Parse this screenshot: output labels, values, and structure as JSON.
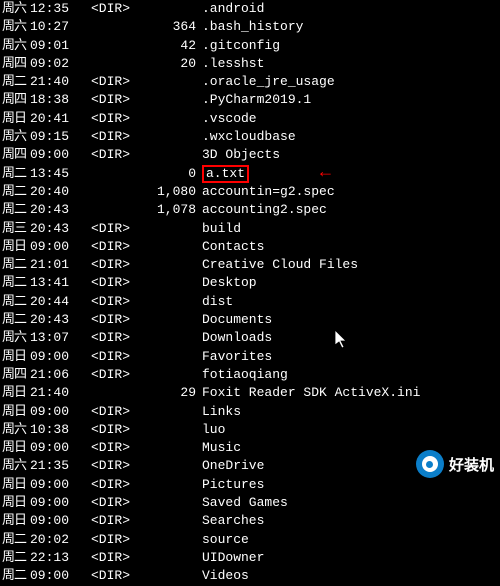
{
  "rows": [
    {
      "day": "六",
      "time": "12:35",
      "dir": "<DIR>",
      "size": "",
      "name": ".android"
    },
    {
      "day": "六",
      "time": "10:27",
      "dir": "",
      "size": "364",
      "name": ".bash_history"
    },
    {
      "day": "六",
      "time": "09:01",
      "dir": "",
      "size": "42",
      "name": ".gitconfig"
    },
    {
      "day": "四",
      "time": "09:02",
      "dir": "",
      "size": "20",
      "name": ".lesshst"
    },
    {
      "day": "二",
      "time": "21:40",
      "dir": "<DIR>",
      "size": "",
      "name": ".oracle_jre_usage"
    },
    {
      "day": "四",
      "time": "18:38",
      "dir": "<DIR>",
      "size": "",
      "name": ".PyCharm2019.1"
    },
    {
      "day": "日",
      "time": "20:41",
      "dir": "<DIR>",
      "size": "",
      "name": ".vscode"
    },
    {
      "day": "六",
      "time": "09:15",
      "dir": "<DIR>",
      "size": "",
      "name": ".wxcloudbase"
    },
    {
      "day": "四",
      "time": "09:00",
      "dir": "<DIR>",
      "size": "",
      "name": "3D Objects"
    },
    {
      "day": "二",
      "time": "13:45",
      "dir": "",
      "size": "0",
      "name": "a.txt",
      "highlight": true
    },
    {
      "day": "二",
      "time": "20:40",
      "dir": "",
      "size": "1,080",
      "name": "accountin=g2.spec"
    },
    {
      "day": "二",
      "time": "20:43",
      "dir": "",
      "size": "1,078",
      "name": "accounting2.spec"
    },
    {
      "day": "三",
      "time": "20:43",
      "dir": "<DIR>",
      "size": "",
      "name": "build"
    },
    {
      "day": "日",
      "time": "09:00",
      "dir": "<DIR>",
      "size": "",
      "name": "Contacts"
    },
    {
      "day": "二",
      "time": "21:01",
      "dir": "<DIR>",
      "size": "",
      "name": "Creative Cloud Files"
    },
    {
      "day": "二",
      "time": "13:41",
      "dir": "<DIR>",
      "size": "",
      "name": "Desktop"
    },
    {
      "day": "二",
      "time": "20:44",
      "dir": "<DIR>",
      "size": "",
      "name": "dist"
    },
    {
      "day": "二",
      "time": "20:43",
      "dir": "<DIR>",
      "size": "",
      "name": "Documents"
    },
    {
      "day": "六",
      "time": "13:07",
      "dir": "<DIR>",
      "size": "",
      "name": "Downloads"
    },
    {
      "day": "日",
      "time": "09:00",
      "dir": "<DIR>",
      "size": "",
      "name": "Favorites"
    },
    {
      "day": "四",
      "time": "21:06",
      "dir": "<DIR>",
      "size": "",
      "name": "fotiaoqiang"
    },
    {
      "day": "日",
      "time": "21:40",
      "dir": "",
      "size": "29",
      "name": "Foxit Reader SDK ActiveX.ini"
    },
    {
      "day": "日",
      "time": "09:00",
      "dir": "<DIR>",
      "size": "",
      "name": "Links"
    },
    {
      "day": "六",
      "time": "10:38",
      "dir": "<DIR>",
      "size": "",
      "name": "luo"
    },
    {
      "day": "日",
      "time": "09:00",
      "dir": "<DIR>",
      "size": "",
      "name": "Music"
    },
    {
      "day": "六",
      "time": "21:35",
      "dir": "<DIR>",
      "size": "",
      "name": "OneDrive"
    },
    {
      "day": "日",
      "time": "09:00",
      "dir": "<DIR>",
      "size": "",
      "name": "Pictures"
    },
    {
      "day": "日",
      "time": "09:00",
      "dir": "<DIR>",
      "size": "",
      "name": "Saved Games"
    },
    {
      "day": "日",
      "time": "09:00",
      "dir": "<DIR>",
      "size": "",
      "name": "Searches"
    },
    {
      "day": "二",
      "time": "20:02",
      "dir": "<DIR>",
      "size": "",
      "name": "source"
    },
    {
      "day": "二",
      "time": "22:13",
      "dir": "<DIR>",
      "size": "",
      "name": "UIDowner"
    },
    {
      "day": "二",
      "time": "09:00",
      "dir": "<DIR>",
      "size": "",
      "name": "Videos"
    }
  ],
  "dayPrefix": "周",
  "arrow": "←",
  "watermark": {
    "text": "好装机"
  }
}
